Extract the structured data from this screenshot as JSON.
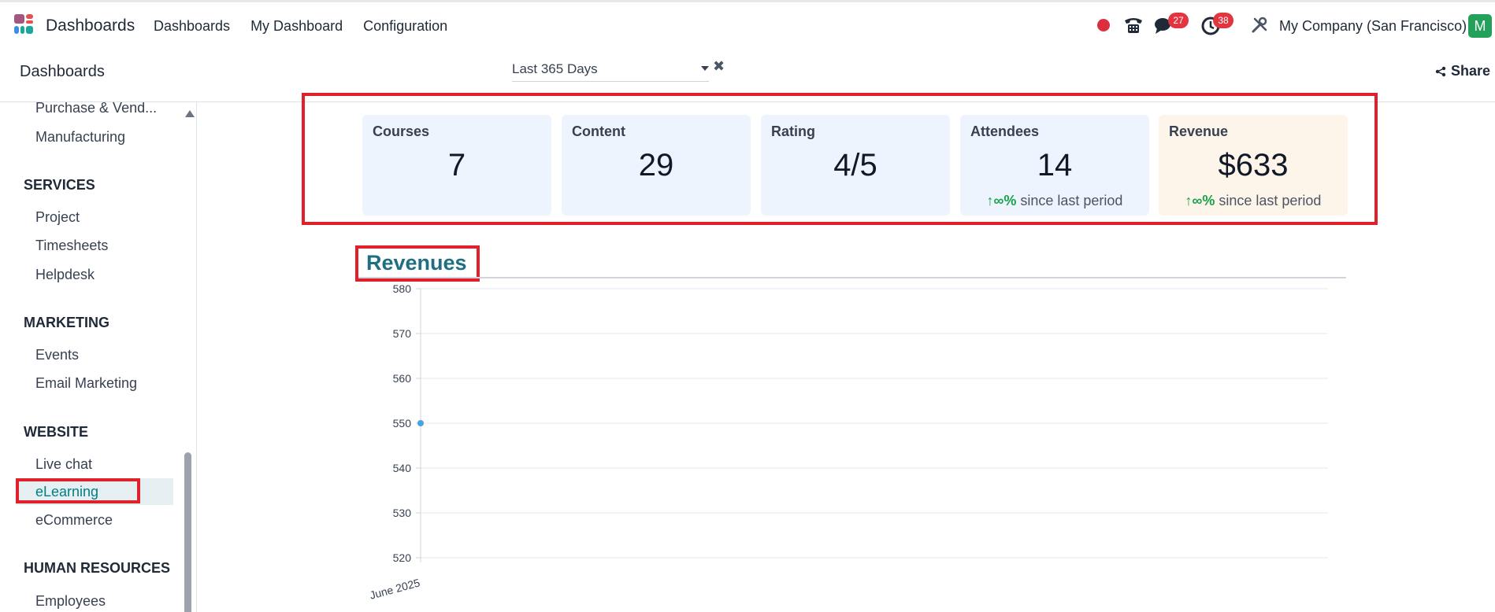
{
  "navbar": {
    "app_name": "Dashboards",
    "menu": [
      "Dashboards",
      "My Dashboard",
      "Configuration"
    ],
    "chat_badge": "27",
    "activity_badge": "38",
    "company": "My Company (San Francisco)",
    "avatar_letter": "M"
  },
  "control": {
    "breadcrumb": "Dashboards",
    "period": "Last 365 Days",
    "share_label": "Share"
  },
  "sidebar": {
    "items": [
      {
        "type": "item",
        "label": "Purchase & Vend..."
      },
      {
        "type": "item",
        "label": "Manufacturing"
      },
      {
        "type": "section",
        "label": "SERVICES"
      },
      {
        "type": "item",
        "label": "Project"
      },
      {
        "type": "item",
        "label": "Timesheets"
      },
      {
        "type": "item",
        "label": "Helpdesk"
      },
      {
        "type": "section",
        "label": "MARKETING"
      },
      {
        "type": "item",
        "label": "Events"
      },
      {
        "type": "item",
        "label": "Email Marketing"
      },
      {
        "type": "section",
        "label": "WEBSITE"
      },
      {
        "type": "item",
        "label": "Live chat"
      },
      {
        "type": "item",
        "label": "eLearning",
        "active": true
      },
      {
        "type": "item",
        "label": "eCommerce"
      },
      {
        "type": "section",
        "label": "HUMAN RESOURCES"
      },
      {
        "type": "item",
        "label": "Employees"
      }
    ]
  },
  "kpis": [
    {
      "title": "Courses",
      "value": "7"
    },
    {
      "title": "Content",
      "value": "29"
    },
    {
      "title": "Rating",
      "value": "4/5"
    },
    {
      "title": "Attendees",
      "value": "14",
      "trend_arrow": "↑∞%",
      "trend_text": " since last period"
    },
    {
      "title": "Revenue",
      "value": "$633",
      "trend_arrow": "↑∞%",
      "trend_text": " since last period"
    }
  ],
  "revenues": {
    "title": "Revenues"
  },
  "chart_data": {
    "type": "line",
    "title": "Revenues",
    "categories": [
      "June 2025"
    ],
    "series": [
      {
        "values": [
          550
        ],
        "color": "#4aa3df"
      }
    ],
    "ylim": [
      520,
      580
    ],
    "yticks": [
      580,
      570,
      560,
      550,
      540,
      530,
      520
    ],
    "grid": true,
    "xlabel": "",
    "ylabel": ""
  },
  "colors": {
    "accent": "#017e84",
    "highlight": "#e0202b",
    "kpi_bg": "#edf4fd",
    "kpi_rev_bg": "#fdf4ea",
    "trend_up": "#16a34a"
  }
}
